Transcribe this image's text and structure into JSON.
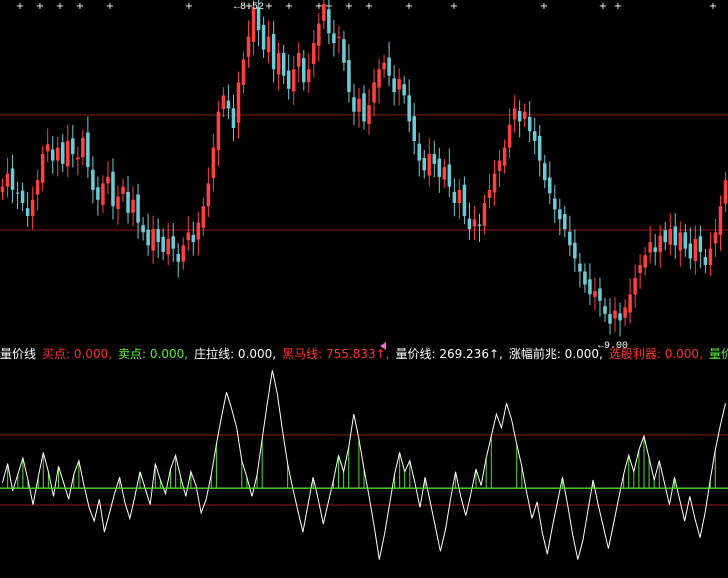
{
  "colors": {
    "background": "#000000",
    "up": "#ff4040",
    "down": "#6ecbd6",
    "gridline": "#8b1a1a",
    "white_line": "#ffffff",
    "green": "#55dd33",
    "red_text": "#ff3030",
    "yellow_text": "#ffff44",
    "magenta_text": "#ff66cc",
    "white_text": "#ffffff",
    "green_text": "#44ee44"
  },
  "price_panel": {
    "high_label": "←8.52",
    "low_label": "←9.00"
  },
  "legend": [
    {
      "label": "量价线",
      "color": "#ffffff"
    },
    {
      "label": "买点: 0.000,",
      "color": "#ff3030"
    },
    {
      "label": "卖点: 0.000,",
      "color": "#55ee33"
    },
    {
      "label": "庄拉线: 0.000,",
      "color": "#ffffff"
    },
    {
      "label": "黑马线: 755.833↑,",
      "color": "#ff3030"
    },
    {
      "label": "量价线: 269.236↑,",
      "color": "#ffffff"
    },
    {
      "label": "涨幅前兆: 0.000,",
      "color": "#ffffff"
    },
    {
      "label": "选股利器: 0.000,",
      "color": "#ff3030"
    },
    {
      "label": "量价先",
      "color": "#55ee33"
    }
  ],
  "chart_data": [
    {
      "type": "candlestick",
      "closes": [
        5.2,
        5.6,
        5.1,
        5.0,
        4.7,
        4.3,
        4.8,
        5.4,
        6.2,
        6.5,
        6.0,
        6.4,
        5.9,
        6.6,
        6.2,
        6.1,
        6.7,
        5.8,
        5.1,
        4.8,
        5.3,
        5.5,
        4.6,
        4.9,
        5.2,
        4.4,
        4.8,
        4.1,
        3.8,
        3.4,
        3.9,
        3.5,
        3.2,
        3.6,
        3.3,
        2.9,
        3.4,
        3.8,
        3.5,
        4.1,
        4.6,
        5.3,
        6.4,
        7.5,
        8.0,
        7.6,
        7.0,
        8.4,
        9.1,
        9.8,
        10.7,
        10.0,
        9.4,
        9.8,
        8.8,
        9.3,
        8.6,
        8.2,
        8.8,
        9.3,
        8.4,
        8.8,
        9.6,
        10.2,
        10.8,
        9.9,
        9.6,
        9.8,
        9.0,
        8.1,
        7.5,
        7.9,
        7.2,
        7.7,
        8.4,
        8.8,
        9.0,
        8.6,
        8.1,
        8.5,
        8.0,
        7.2,
        6.6,
        6.0,
        5.7,
        6.2,
        5.9,
        5.5,
        5.8,
        5.2,
        4.7,
        5.1,
        4.3,
        3.9,
        4.2,
        4.0,
        4.7,
        5.1,
        5.6,
        6.0,
        6.4,
        7.1,
        7.6,
        7.2,
        7.5,
        6.9,
        6.6,
        6.0,
        5.4,
        5.0,
        4.5,
        4.2,
        3.9,
        3.4,
        3.0,
        2.6,
        2.2,
        1.9,
        2.0,
        1.7,
        1.3,
        1.0,
        1.4,
        1.1,
        1.5,
        1.9,
        2.4,
        2.8,
        3.1,
        3.5,
        3.2,
        3.7,
        3.5,
        3.9,
        3.4,
        3.8,
        3.3,
        3.0,
        3.6,
        3.2,
        2.8,
        3.3,
        3.8,
        4.6,
        5.4
      ],
      "y_range": [
        0.5,
        10.8
      ],
      "marked_high": "8.52",
      "marked_low": "9.00",
      "gridlines": 3
    },
    {
      "type": "line",
      "series": [
        {
          "values": [
            0.2,
            0.9,
            -0.1,
            0.5,
            1.1,
            0.3,
            -0.6,
            0.4,
            1.3,
            0.6,
            -0.3,
            0.8,
            0.2,
            -0.4,
            0.5,
            1.0,
            0.1,
            -0.7,
            -1.2,
            -0.4,
            -1.6,
            -0.9,
            -0.2,
            0.4,
            -0.5,
            -1.1,
            -0.3,
            0.6,
            0.0,
            -0.6,
            0.9,
            0.3,
            -0.2,
            0.7,
            1.2,
            0.4,
            -0.3,
            0.6,
            0.1,
            -0.9,
            -0.4,
            0.5,
            1.6,
            2.6,
            3.5,
            2.9,
            2.2,
            1.0,
            0.4,
            -0.3,
            0.5,
            1.8,
            3.1,
            4.3,
            3.4,
            2.1,
            0.9,
            0.0,
            -0.8,
            -1.6,
            -0.6,
            0.4,
            -0.4,
            -1.3,
            -0.5,
            0.3,
            1.2,
            0.6,
            1.5,
            2.7,
            1.8,
            0.7,
            -0.3,
            -1.4,
            -2.6,
            -1.7,
            -0.6,
            0.5,
            1.3,
            0.6,
            1.0,
            0.2,
            -0.7,
            0.4,
            -0.5,
            -1.4,
            -2.3,
            -1.5,
            -0.4,
            0.6,
            -0.3,
            -1.0,
            -0.2,
            0.7,
            0.1,
            1.1,
            1.9,
            2.7,
            2.2,
            3.1,
            2.5,
            1.6,
            0.8,
            -0.2,
            -1.1,
            -0.5,
            -1.6,
            -2.4,
            -1.4,
            -0.5,
            0.4,
            -0.6,
            -1.7,
            -2.6,
            -1.9,
            -0.8,
            0.3,
            -0.6,
            -1.4,
            -2.2,
            -1.3,
            -0.4,
            0.5,
            1.2,
            0.6,
            1.4,
            1.9,
            1.1,
            0.3,
            1.0,
            0.2,
            -0.6,
            0.4,
            -0.4,
            -1.2,
            -0.3,
            -1.1,
            -1.8,
            -0.9,
            0.3,
            1.4,
            2.3,
            3.1
          ]
        },
        {
          "values": [
            0,
            0,
            0.0,
            0,
            0,
            0,
            0,
            0,
            0,
            0,
            0,
            0,
            0,
            0,
            0,
            0,
            0,
            0,
            0,
            0,
            0,
            0,
            0,
            0,
            0,
            0,
            0,
            0,
            0,
            0,
            0,
            0,
            0,
            0,
            0,
            0,
            0,
            0,
            0,
            0,
            0,
            0,
            0,
            0,
            0,
            0,
            0,
            0,
            0,
            0,
            0,
            0,
            0,
            0,
            0,
            0,
            0,
            0,
            0,
            0,
            0,
            0,
            0,
            0,
            0,
            0,
            0,
            0,
            0,
            0,
            0,
            0,
            0,
            0,
            0,
            0,
            0,
            0,
            0,
            0,
            0,
            0,
            0,
            0,
            0,
            0,
            0,
            0,
            0,
            0,
            0,
            0,
            0,
            0,
            0,
            0,
            0,
            0,
            0,
            0,
            0,
            0,
            0,
            0,
            0,
            0,
            0,
            0,
            0,
            0,
            0,
            0,
            0,
            0,
            0,
            0,
            0,
            0,
            0,
            0,
            0,
            0,
            0,
            0,
            0,
            0,
            0,
            0,
            0,
            0,
            0,
            0,
            0,
            0,
            0,
            0,
            0,
            0,
            0,
            0,
            0,
            0,
            0,
            0,
            0
          ]
        }
      ],
      "y_range": [
        -3.2,
        4.6
      ]
    }
  ]
}
